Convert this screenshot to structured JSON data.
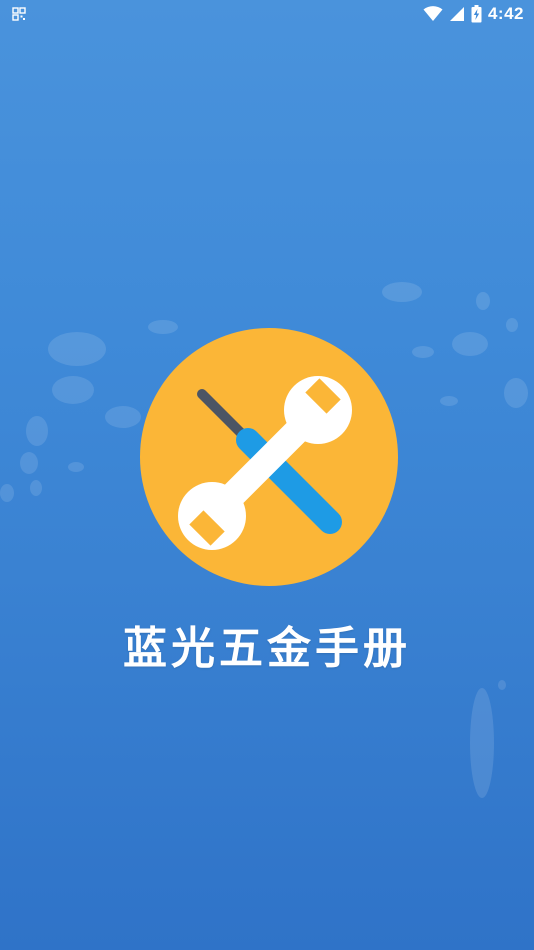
{
  "status_bar": {
    "time": "4:42",
    "left_icon": "qr-code-icon",
    "right_icons": [
      "wifi-icon",
      "cellular-signal-icon",
      "battery-charging-icon"
    ]
  },
  "splash": {
    "logo_icon": "wrench-screwdriver-icon",
    "app_name": "蓝光五金手册"
  },
  "colors": {
    "background_top": "#4a93dc",
    "background_bottom": "#2f73c8",
    "logo_circle": "#fbb637",
    "screwdriver_handle": "#1e9be5",
    "screwdriver_tip": "#4c5564",
    "wrench": "#ffffff",
    "title": "#ffffff"
  }
}
